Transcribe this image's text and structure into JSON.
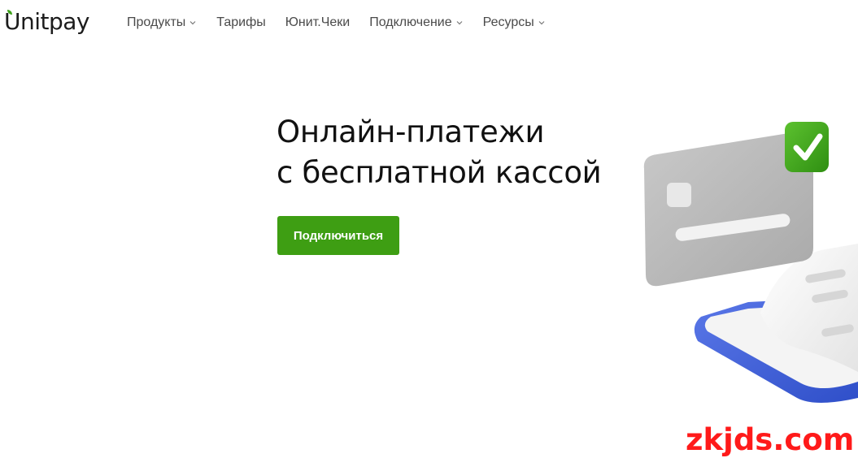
{
  "header": {
    "logo_text": "Unitpay",
    "nav": [
      {
        "label": "Продукты",
        "has_dropdown": true
      },
      {
        "label": "Тарифы",
        "has_dropdown": false
      },
      {
        "label": "Юнит.Чеки",
        "has_dropdown": false
      },
      {
        "label": "Подключение",
        "has_dropdown": true
      },
      {
        "label": "Ресурсы",
        "has_dropdown": true
      }
    ]
  },
  "hero": {
    "title_line1": "Онлайн-платежи",
    "title_line2": "с бесплатной кассой",
    "cta_label": "Подключиться"
  },
  "watermark": "zkjds.com",
  "colors": {
    "brand_green": "#3e9e13",
    "card_gray": "#b8b8b8",
    "terminal_blue": "#3f5fd6",
    "watermark_red": "#ff1a1a"
  }
}
